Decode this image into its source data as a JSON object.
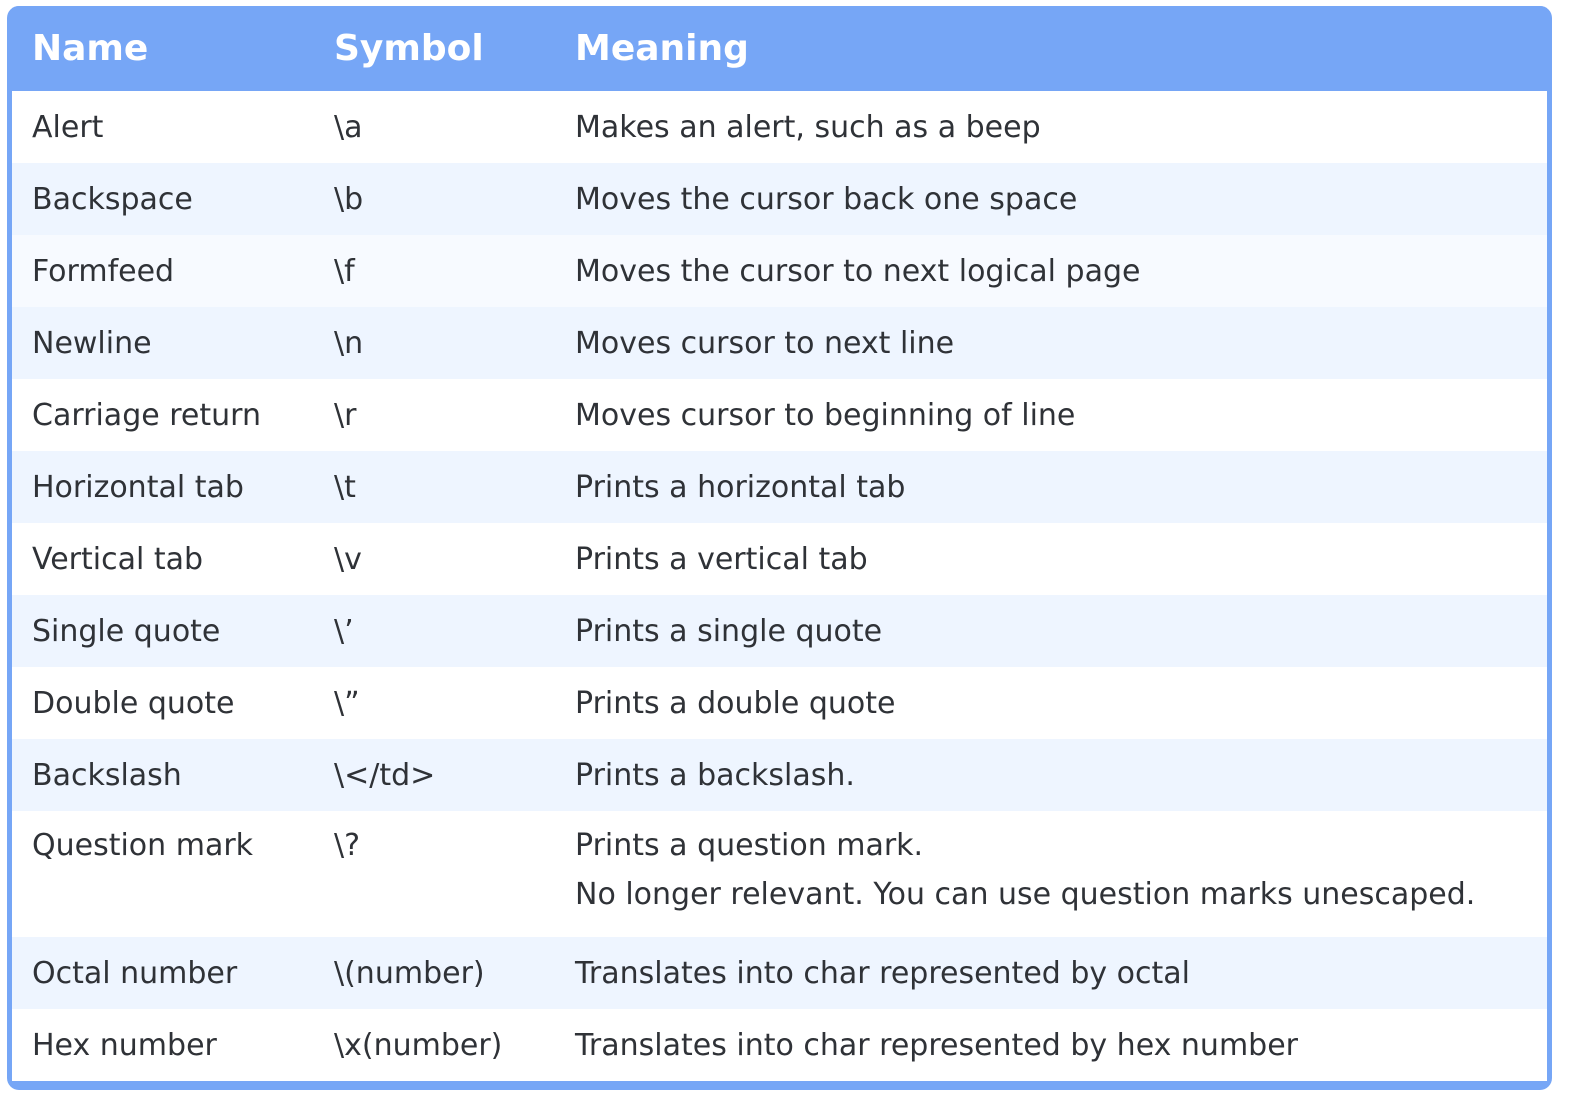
{
  "table": {
    "headers": [
      "Name",
      "Symbol",
      "Meaning"
    ],
    "rows": [
      {
        "name": "Alert",
        "symbol": "\\a",
        "meaning": "Makes an alert, such as a beep"
      },
      {
        "name": "Backspace",
        "symbol": "\\b",
        "meaning": "Moves the cursor back one space"
      },
      {
        "name": "Formfeed",
        "symbol": "\\f",
        "meaning": "Moves the cursor to next logical page"
      },
      {
        "name": "Newline",
        "symbol": "\\n",
        "meaning": "Moves cursor to next line"
      },
      {
        "name": "Carriage return",
        "symbol": "\\r",
        "meaning": "Moves cursor to beginning of line"
      },
      {
        "name": "Horizontal tab",
        "symbol": "\\t",
        "meaning": "Prints a horizontal tab"
      },
      {
        "name": "Vertical tab",
        "symbol": "\\v",
        "meaning": "Prints a vertical tab"
      },
      {
        "name": "Single quote",
        "symbol": "\\’",
        "meaning": "Prints a single quote"
      },
      {
        "name": "Double quote",
        "symbol": "\\”",
        "meaning": "Prints a double quote"
      },
      {
        "name": "Backslash",
        "symbol": "\\</td>",
        "meaning": "Prints a backslash."
      },
      {
        "name": "Question mark",
        "symbol": "\\?",
        "meaning": "Prints a question mark.",
        "meaning_line2": "No longer relevant. You can use question marks unescaped."
      },
      {
        "name": "Octal number",
        "symbol": "\\(number)",
        "meaning": "Translates into char represented by octal"
      },
      {
        "name": "Hex number",
        "symbol": "\\x(number)",
        "meaning": "Translates into char represented by hex number"
      }
    ]
  },
  "colors": {
    "header_bg": "#76a6f6",
    "header_text": "#ffffff",
    "row_alt_bg": "#eef5ff",
    "body_text": "#2f3237"
  }
}
